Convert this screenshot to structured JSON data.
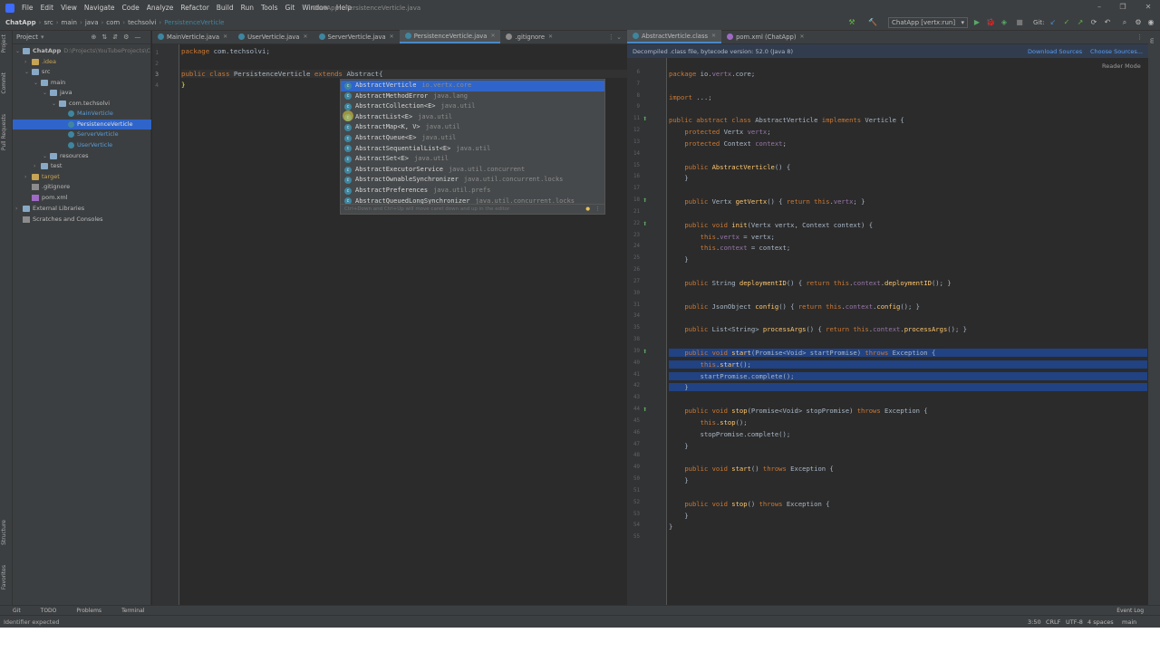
{
  "menu": [
    "File",
    "Edit",
    "View",
    "Navigate",
    "Code",
    "Analyze",
    "Refactor",
    "Build",
    "Run",
    "Tools",
    "Git",
    "Window",
    "Help"
  ],
  "window_title": "ChatApp - PersistenceVerticle.java",
  "breadcrumbs": [
    "ChatApp",
    "src",
    "main",
    "java",
    "com",
    "techsolvi",
    "PersistenceVerticle"
  ],
  "run_config": "ChatApp [vertx:run]",
  "git_label": "Git:",
  "project_panel": {
    "title": "Project",
    "tree": [
      {
        "label": "ChatApp",
        "extra": "D:\\Projects\\YouTubeProjects\\C",
        "depth": 0,
        "type": "folder",
        "bold": true
      },
      {
        "label": ".idea",
        "depth": 1,
        "type": "folder-y"
      },
      {
        "label": "src",
        "depth": 1,
        "type": "folder"
      },
      {
        "label": "main",
        "depth": 2,
        "type": "folder"
      },
      {
        "label": "java",
        "depth": 3,
        "type": "folder"
      },
      {
        "label": "com.techsolvi",
        "depth": 4,
        "type": "folder"
      },
      {
        "label": "MainVerticle",
        "depth": 5,
        "type": "class"
      },
      {
        "label": "PersistenceVerticle",
        "depth": 5,
        "type": "class",
        "selected": true
      },
      {
        "label": "ServerVerticle",
        "depth": 5,
        "type": "class"
      },
      {
        "label": "UserVerticle",
        "depth": 5,
        "type": "class"
      },
      {
        "label": "resources",
        "depth": 3,
        "type": "folder"
      },
      {
        "label": "test",
        "depth": 2,
        "type": "folder"
      },
      {
        "label": "target",
        "depth": 1,
        "type": "folder-y"
      },
      {
        "label": ".gitignore",
        "depth": 1,
        "type": "file"
      },
      {
        "label": "pom.xml",
        "depth": 1,
        "type": "xml"
      },
      {
        "label": "External Libraries",
        "depth": 0,
        "type": "folder"
      },
      {
        "label": "Scratches and Consoles",
        "depth": 0,
        "type": "file"
      }
    ]
  },
  "left_tabs": [
    "MainVerticle.java",
    "UserVerticle.java",
    "ServerVerticle.java",
    "PersistenceVerticle.java",
    ".gitignore"
  ],
  "right_tabs": [
    "AbstractVerticle.class",
    "pom.xml (ChatApp)"
  ],
  "left_code": {
    "line_numbers": [
      "1",
      "2",
      "3",
      "4"
    ],
    "package_line": "package com.techsolvi;",
    "class_line": "public class PersistenceVerticle extends Abstract{",
    "close_line": "}"
  },
  "completion": {
    "items": [
      {
        "name": "AbstractVerticle",
        "pkg": "io.vertx.core"
      },
      {
        "name": "AbstractMethodError",
        "pkg": "java.lang"
      },
      {
        "name": "AbstractCollection<E>",
        "pkg": "java.util"
      },
      {
        "name": "AbstractList<E>",
        "pkg": "java.util"
      },
      {
        "name": "AbstractMap<K, V>",
        "pkg": "java.util"
      },
      {
        "name": "AbstractQueue<E>",
        "pkg": "java.util"
      },
      {
        "name": "AbstractSequentialList<E>",
        "pkg": "java.util"
      },
      {
        "name": "AbstractSet<E>",
        "pkg": "java.util"
      },
      {
        "name": "AbstractExecutorService",
        "pkg": "java.util.concurrent"
      },
      {
        "name": "AbstractOwnableSynchronizer",
        "pkg": "java.util.concurrent.locks"
      },
      {
        "name": "AbstractPreferences",
        "pkg": "java.util.prefs"
      },
      {
        "name": "AbstractQueuedLongSynchronizer",
        "pkg": "java.util.concurrent.locks"
      }
    ],
    "footer": "Ctrl+Down and Ctrl+Up will move caret down and up in the editor"
  },
  "decompiled_banner": "Decompiled .class file, bytecode version: 52.0 (Java 8)",
  "download_sources": "Download Sources",
  "choose_sources": "Choose Sources...",
  "reader_mode": "Reader Mode",
  "right_code": [
    {
      "ln": "6",
      "text": "package io.vertx.core;"
    },
    {
      "ln": "7",
      "text": ""
    },
    {
      "ln": "8",
      "text": "import ...;"
    },
    {
      "ln": "9",
      "text": ""
    },
    {
      "ln": "11",
      "text": "public abstract class AbstractVerticle implements Verticle {",
      "mark": "o"
    },
    {
      "ln": "12",
      "text": "    protected Vertx vertx;"
    },
    {
      "ln": "13",
      "text": "    protected Context context;"
    },
    {
      "ln": "14",
      "text": ""
    },
    {
      "ln": "15",
      "text": "    public AbstractVerticle() {"
    },
    {
      "ln": "16",
      "text": "    }"
    },
    {
      "ln": "17",
      "text": ""
    },
    {
      "ln": "18",
      "text": "    public Vertx getVertx() { return this.vertx; }",
      "mark": "o"
    },
    {
      "ln": "21",
      "text": ""
    },
    {
      "ln": "22",
      "text": "    public void init(Vertx vertx, Context context) {",
      "mark": "o"
    },
    {
      "ln": "23",
      "text": "        this.vertx = vertx;"
    },
    {
      "ln": "24",
      "text": "        this.context = context;"
    },
    {
      "ln": "25",
      "text": "    }"
    },
    {
      "ln": "26",
      "text": ""
    },
    {
      "ln": "27",
      "text": "    public String deploymentID() { return this.context.deploymentID(); }"
    },
    {
      "ln": "30",
      "text": ""
    },
    {
      "ln": "31",
      "text": "    public JsonObject config() { return this.context.config(); }"
    },
    {
      "ln": "34",
      "text": ""
    },
    {
      "ln": "35",
      "text": "    public List<String> processArgs() { return this.context.processArgs(); }"
    },
    {
      "ln": "38",
      "text": ""
    },
    {
      "ln": "39",
      "text": "    public void start(Promise<Void> startPromise) throws Exception {",
      "mark": "o",
      "hl": true
    },
    {
      "ln": "40",
      "text": "        this.start();",
      "hl": true
    },
    {
      "ln": "41",
      "text": "        startPromise.complete();",
      "hl": true
    },
    {
      "ln": "42",
      "text": "    }",
      "hl": true
    },
    {
      "ln": "43",
      "text": ""
    },
    {
      "ln": "44",
      "text": "    public void stop(Promise<Void> stopPromise) throws Exception {",
      "mark": "o"
    },
    {
      "ln": "45",
      "text": "        this.stop();"
    },
    {
      "ln": "46",
      "text": "        stopPromise.complete();"
    },
    {
      "ln": "47",
      "text": "    }"
    },
    {
      "ln": "48",
      "text": ""
    },
    {
      "ln": "49",
      "text": "    public void start() throws Exception {"
    },
    {
      "ln": "50",
      "text": "    }"
    },
    {
      "ln": "51",
      "text": ""
    },
    {
      "ln": "52",
      "text": "    public void stop() throws Exception {"
    },
    {
      "ln": "53",
      "text": "    }"
    },
    {
      "ln": "54",
      "text": "}"
    },
    {
      "ln": "55",
      "text": ""
    }
  ],
  "bottom_tools": [
    "Git",
    "TODO",
    "Problems",
    "Terminal"
  ],
  "event_log": "Event Log",
  "status": {
    "message": "Identifier expected",
    "position": "3:50",
    "line_sep": "CRLF",
    "encoding": "UTF-8",
    "indent": "4 spaces",
    "branch": "main"
  },
  "side_tabs_left": [
    "Project",
    "Commit",
    "Pull Requests",
    "Structure",
    "Favorites"
  ],
  "colors": {
    "accent": "#2f65ca",
    "keyword": "#cc7832",
    "selection": "#214283"
  }
}
